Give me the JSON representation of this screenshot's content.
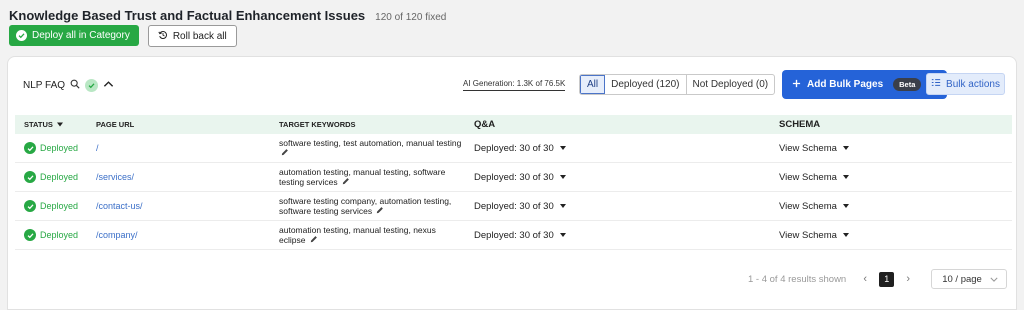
{
  "header": {
    "title": "Knowledge Based Trust and Factual Enhancement Issues",
    "fixed_count": "120 of 120 fixed"
  },
  "actions": {
    "deploy_label": "Deploy all in Category",
    "rollback_label": "Roll back all"
  },
  "toolbar": {
    "section_label": "NLP FAQ",
    "ai_generation": "AI Generation: 1.3K of 76.5K",
    "filters": [
      {
        "label": "All",
        "active": true
      },
      {
        "label": "Deployed (120)",
        "active": false
      },
      {
        "label": "Not Deployed (0)",
        "active": false
      }
    ],
    "add_bulk_pages_label": "Add Bulk Pages",
    "beta_label": "Beta",
    "bulk_actions_label": "Bulk actions"
  },
  "table": {
    "columns": [
      "STATUS",
      "PAGE URL",
      "TARGET KEYWORDS",
      "Q&A",
      "SCHEMA"
    ],
    "rows": [
      {
        "status": "Deployed",
        "url": "/",
        "keywords": "software testing, test automation, manual testing",
        "qa": "Deployed: 30 of 30",
        "schema": "View Schema"
      },
      {
        "status": "Deployed",
        "url": "/services/",
        "keywords": "automation testing, manual testing, software testing services",
        "qa": "Deployed: 30 of 30",
        "schema": "View Schema"
      },
      {
        "status": "Deployed",
        "url": "/contact-us/",
        "keywords": "software testing company, automation testing, software testing services",
        "qa": "Deployed: 30 of 30",
        "schema": "View Schema"
      },
      {
        "status": "Deployed",
        "url": "/company/",
        "keywords": "automation testing, manual testing, nexus eclipse",
        "qa": "Deployed: 30 of 30",
        "schema": "View Schema"
      }
    ]
  },
  "pagination": {
    "results_text": "1 - 4 of 4 results shown",
    "current_page": "1",
    "page_size": "10 / page"
  },
  "colors": {
    "success": "#27a844",
    "primary": "#2563d8",
    "link": "#3b6fc8",
    "header_row_bg": "#e9f5ee"
  }
}
